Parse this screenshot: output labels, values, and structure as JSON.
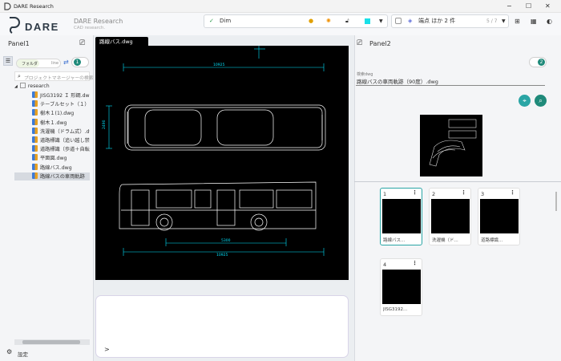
{
  "window": {
    "title": "DARE Research"
  },
  "brand": {
    "name": "DARE",
    "project": "DARE Research",
    "project_sub": "CAD research."
  },
  "toolbar": {
    "dim_label": "Dim",
    "points_label": "端点 ほか 2 件",
    "points_count": "5 / 7"
  },
  "panel1": {
    "title": "Panel1",
    "seg_folder": "フォルダ",
    "seg_line": "line",
    "badge": "1",
    "search_placeholder": "プロジェクトマネージャーの検索",
    "root": "research",
    "files": [
      "JISG3192 Ｉ 形鋼.dwg",
      "テーブルセット（１）.dwg",
      "樹木１(1).dwg",
      "樹木１.dwg",
      "洗濯機（ドラム式）.dwg",
      "道路標識（追い越し禁止）.dwg",
      "道路標識（歩道＋自転車）.dwg",
      "平面図.dwg",
      "路線バス.dwg",
      "路線バスの車両軌跡"
    ],
    "selected_index": 9,
    "settings": "設定"
  },
  "canvas": {
    "tab": "路線バス.dwg",
    "dim_top": "10925",
    "dim_side": "2490",
    "dim_mid": "5300",
    "dim_bottom": "10925"
  },
  "chat": {
    "prompt": ">"
  },
  "panel2": {
    "title": "Panel2",
    "badge": "2",
    "search_label": "検索dwg",
    "search_value": "路線バスの車両軌跡（90度）.dwg",
    "results": [
      {
        "no": "1",
        "caption": "路線バス..."
      },
      {
        "no": "2",
        "caption": "洗濯機（ド..."
      },
      {
        "no": "3",
        "caption": "道路標識..."
      },
      {
        "no": "4",
        "caption": "JISG3192..."
      }
    ]
  },
  "colors": {
    "accent": "#2aa5a5",
    "cad_cyan": "#00e5ff",
    "badge_green": "#1f8a7a"
  }
}
